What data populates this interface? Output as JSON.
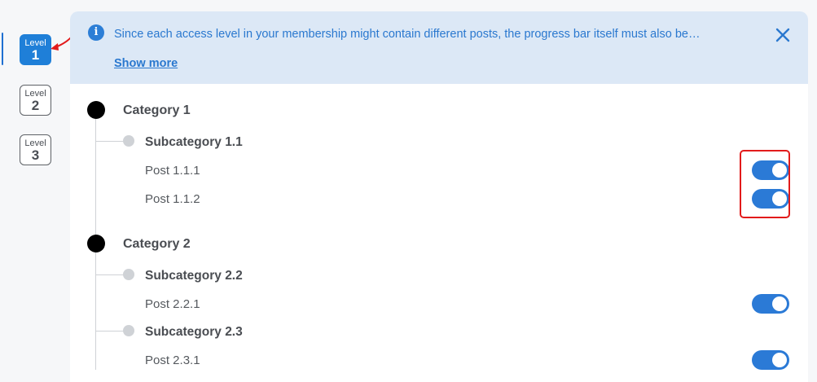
{
  "levels": [
    {
      "word": "Level",
      "num": "1",
      "active": true
    },
    {
      "word": "Level",
      "num": "2",
      "active": false
    },
    {
      "word": "Level",
      "num": "3",
      "active": false
    }
  ],
  "notice": {
    "text": "Since each access level in your membership might contain different posts, the progress bar itself must also be…",
    "show_more": "Show more"
  },
  "tree": {
    "categories": [
      {
        "label": "Category 1",
        "subcategories": [
          {
            "label": "Subcategory 1.1",
            "posts": [
              {
                "label": "Post 1.1.1",
                "enabled": true
              },
              {
                "label": "Post 1.1.2",
                "enabled": true
              }
            ]
          }
        ]
      },
      {
        "label": "Category 2",
        "subcategories": [
          {
            "label": "Subcategory 2.2",
            "posts": [
              {
                "label": "Post 2.2.1",
                "enabled": true
              }
            ]
          },
          {
            "label": "Subcategory 2.3",
            "posts": [
              {
                "label": "Post 2.3.1",
                "enabled": true
              }
            ]
          }
        ]
      }
    ]
  },
  "colors": {
    "accent": "#2b7ad6",
    "notice_bg": "#dce8f6",
    "annotation_red": "#e21b1b"
  }
}
